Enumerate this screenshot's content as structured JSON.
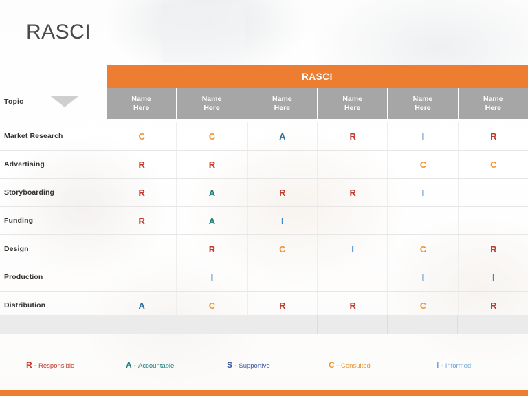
{
  "slide": {
    "title": "RASCI",
    "accent_color": "#ed7d31",
    "header_gray": "#a6a6a6"
  },
  "table": {
    "banner": "RASCI",
    "topic_header": "Topic",
    "column_headers": [
      {
        "line1": "Name",
        "line2": "Here"
      },
      {
        "line1": "Name",
        "line2": "Here"
      },
      {
        "line1": "Name",
        "line2": "Here"
      },
      {
        "line1": "Name",
        "line2": "Here"
      },
      {
        "line1": "Name",
        "line2": "Here"
      },
      {
        "line1": "Name",
        "line2": "Here"
      }
    ],
    "rows": [
      {
        "label": "Market Research",
        "cells": [
          "C",
          "C",
          "A",
          "R",
          "I",
          "R"
        ]
      },
      {
        "label": "Advertising",
        "cells": [
          "R",
          "R",
          "",
          "",
          "C",
          "C"
        ]
      },
      {
        "label": "Storyboarding",
        "cells": [
          "R",
          "A",
          "R",
          "R",
          "I",
          ""
        ]
      },
      {
        "label": "Funding",
        "cells": [
          "R",
          "A",
          "I",
          "",
          "",
          ""
        ]
      },
      {
        "label": "Design",
        "cells": [
          "",
          "R",
          "C",
          "I",
          "C",
          "R"
        ]
      },
      {
        "label": "Production",
        "cells": [
          "",
          "I",
          "",
          "",
          "I",
          "I"
        ]
      },
      {
        "label": "Distribution",
        "cells": [
          "A",
          "C",
          "R",
          "R",
          "C",
          "R"
        ]
      }
    ]
  },
  "legend": {
    "items": [
      {
        "key": "R",
        "dash": "-",
        "label": "Responsible",
        "color": "#c0392b"
      },
      {
        "key": "A",
        "dash": "-",
        "label": "Accountable",
        "color": "#1a7f7a"
      },
      {
        "key": "S",
        "dash": "-",
        "label": "Supportive",
        "color": "#3b5ba5"
      },
      {
        "key": "C",
        "dash": "-",
        "label": "Consulted",
        "color": "#f0952f"
      },
      {
        "key": "I",
        "dash": "-",
        "label": "Informed",
        "color": "#6aa6d6"
      }
    ]
  }
}
